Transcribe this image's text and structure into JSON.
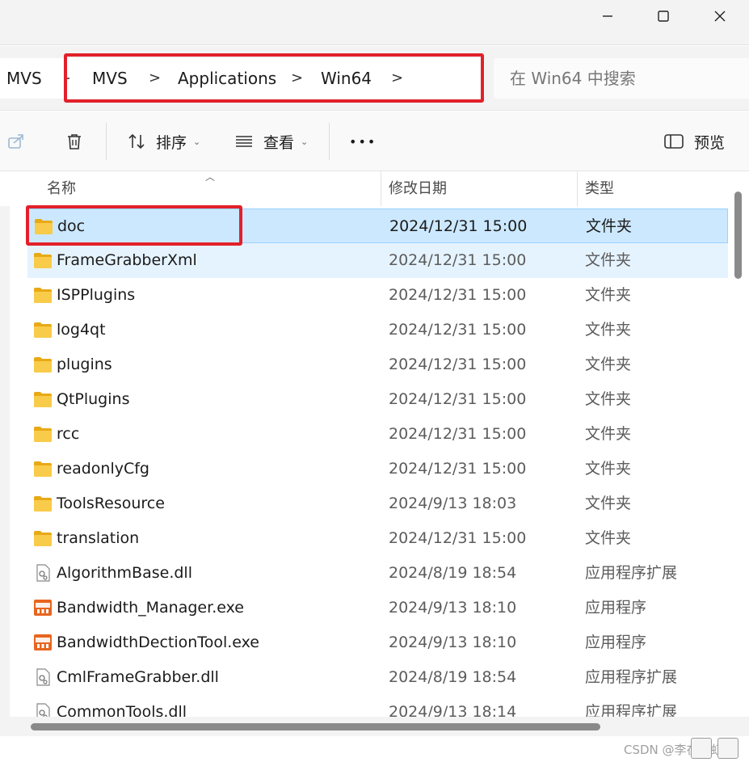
{
  "window": {
    "minimize_glyph": "—",
    "maximize_glyph": "☐",
    "close_glyph": "✕"
  },
  "breadcrumb": {
    "prefix": "MVS",
    "items": [
      "MVS",
      "Applications",
      "Win64"
    ],
    "separator": ">"
  },
  "search": {
    "placeholder": "在 Win64 中搜索"
  },
  "toolbar": {
    "share_icon": "share-icon",
    "delete_icon": "trash-icon",
    "sort_label": "排序",
    "view_label": "查看",
    "more_label": "•••",
    "preview_label": "预览"
  },
  "columns": {
    "name": "名称",
    "date": "修改日期",
    "type": "类型"
  },
  "files": [
    {
      "name": "doc",
      "date": "2024/12/31 15:00",
      "type": "文件夹",
      "icon": "folder-icon"
    },
    {
      "name": "FrameGrabberXml",
      "date": "2024/12/31 15:00",
      "type": "文件夹",
      "icon": "folder-icon"
    },
    {
      "name": "ISPPlugins",
      "date": "2024/12/31 15:00",
      "type": "文件夹",
      "icon": "folder-icon"
    },
    {
      "name": "log4qt",
      "date": "2024/12/31 15:00",
      "type": "文件夹",
      "icon": "folder-icon"
    },
    {
      "name": "plugins",
      "date": "2024/12/31 15:00",
      "type": "文件夹",
      "icon": "folder-icon"
    },
    {
      "name": "QtPlugins",
      "date": "2024/12/31 15:00",
      "type": "文件夹",
      "icon": "folder-icon"
    },
    {
      "name": "rcc",
      "date": "2024/12/31 15:00",
      "type": "文件夹",
      "icon": "folder-icon"
    },
    {
      "name": "readonlyCfg",
      "date": "2024/12/31 15:00",
      "type": "文件夹",
      "icon": "folder-icon"
    },
    {
      "name": "ToolsResource",
      "date": "2024/9/13 18:03",
      "type": "文件夹",
      "icon": "folder-icon"
    },
    {
      "name": "translation",
      "date": "2024/12/31 15:00",
      "type": "文件夹",
      "icon": "folder-icon"
    },
    {
      "name": "AlgorithmBase.dll",
      "date": "2024/8/19 18:54",
      "type": "应用程序扩展",
      "icon": "dll-icon"
    },
    {
      "name": "Bandwidth_Manager.exe",
      "date": "2024/9/13 18:10",
      "type": "应用程序",
      "icon": "exe-icon"
    },
    {
      "name": "BandwidthDectionTool.exe",
      "date": "2024/9/13 18:10",
      "type": "应用程序",
      "icon": "exe-icon"
    },
    {
      "name": "CmlFrameGrabber.dll",
      "date": "2024/8/19 18:54",
      "type": "应用程序扩展",
      "icon": "dll-icon"
    },
    {
      "name": "CommonTools.dll",
      "date": "2024/9/13 18:14",
      "type": "应用程序扩展",
      "icon": "dll-icon"
    }
  ],
  "watermark": "CSDN @李在学虹吗",
  "colors": {
    "highlight_box": "#e2202a",
    "selected_row": "#cce8ff",
    "hover_row": "#e5f3ff",
    "folder": "#f5c842"
  }
}
